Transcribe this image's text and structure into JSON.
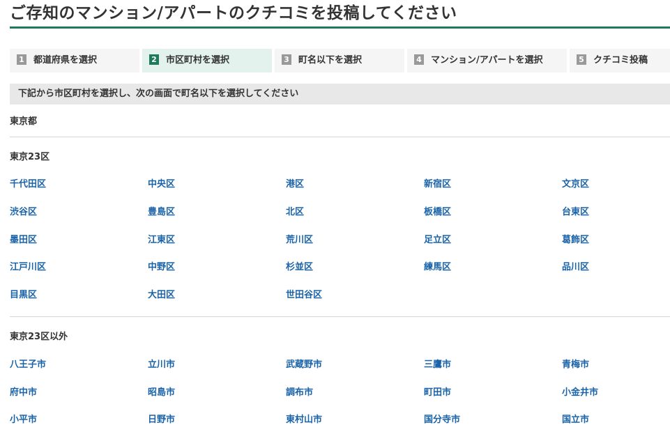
{
  "page_title": "ご存知のマンション/アパートのクチコミを投稿してください",
  "steps": [
    {
      "num": "1",
      "label": "都道府県を選択"
    },
    {
      "num": "2",
      "label": "市区町村を選択"
    },
    {
      "num": "3",
      "label": "町名以下を選択"
    },
    {
      "num": "4",
      "label": "マンション/アパートを選択"
    },
    {
      "num": "5",
      "label": "クチコミ投稿"
    }
  ],
  "active_step": "2",
  "instruction": "下記から市区町村を選択し、次の画面で町名以下を選択してください",
  "prefecture": "東京都",
  "groups": [
    {
      "title": "東京23区",
      "items": [
        "千代田区",
        "中央区",
        "港区",
        "新宿区",
        "文京区",
        "渋谷区",
        "豊島区",
        "北区",
        "板橋区",
        "台東区",
        "墨田区",
        "江東区",
        "荒川区",
        "足立区",
        "葛飾区",
        "江戸川区",
        "中野区",
        "杉並区",
        "練馬区",
        "品川区",
        "目黒区",
        "大田区",
        "世田谷区"
      ]
    },
    {
      "title": "東京23区以外",
      "items": [
        "八王子市",
        "立川市",
        "武蔵野市",
        "三鷹市",
        "青梅市",
        "府中市",
        "昭島市",
        "調布市",
        "町田市",
        "小金井市",
        "小平市",
        "日野市",
        "東村山市",
        "国分寺市",
        "国立市"
      ]
    }
  ],
  "colors": {
    "accent": "#1e7a5a",
    "link": "#1a63a8",
    "active_step_bg": "#e4f2ee"
  }
}
